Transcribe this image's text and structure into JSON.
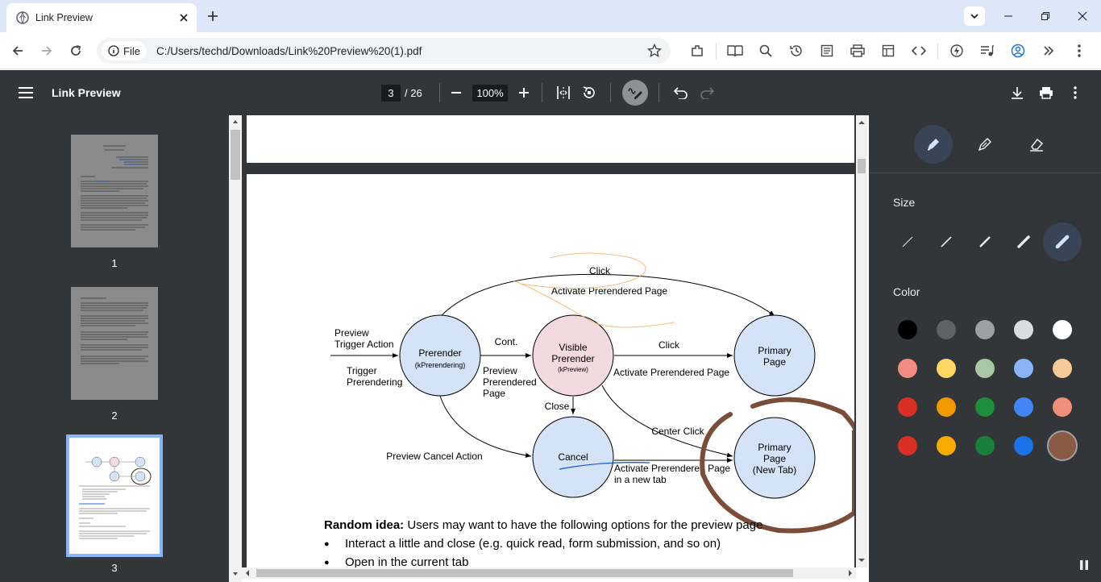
{
  "browser": {
    "tab_title": "Link Preview",
    "file_chip": "File",
    "url": "C:/Users/techd/Downloads/Link%20Preview%20(1).pdf"
  },
  "pdf_toolbar": {
    "title": "Link Preview",
    "current_page": "3",
    "total_pages": "/ 26",
    "zoom": "100%"
  },
  "thumbnails": {
    "labels": [
      "1",
      "2",
      "3"
    ],
    "selected": "3"
  },
  "diagram": {
    "click_top": "Click",
    "activate_top": "Activate Prerendered Page",
    "preview_trigger_1": "Preview",
    "preview_trigger_2": "Trigger Action",
    "trigger_prerendering_1": "Trigger",
    "trigger_prerendering_2": "Prerendering",
    "prerender_1": "Prerender",
    "prerender_2": "(kPrerendering)",
    "cont": "Cont.",
    "visible_1": "Visible",
    "visible_2": "Prerender",
    "visible_3": "(kPreview)",
    "preview_prerendered_1": "Preview",
    "preview_prerendered_2": "Prerendered",
    "preview_prerendered_3": "Page",
    "click_mid": "Click",
    "activate_mid": "Activate Prerendered Page",
    "primary_1": "Primary",
    "primary_2": "Page",
    "close": "Close",
    "center_click": "Center Click",
    "preview_cancel": "Preview Cancel Action",
    "cancel": "Cancel",
    "activate_newtab_1": "Activate Prerendered Page",
    "activate_newtab_2": "in a new tab",
    "newtab_1": "Primary",
    "newtab_2": "Page",
    "newtab_3": "(New Tab)"
  },
  "body_text": {
    "idea_label": "Random idea:",
    "idea_text": " Users may want to have the following options for the preview page",
    "bullet_1": "Interact a little and close (e.g. quick read, form submission, and so on)",
    "bullet_2": "Open in the current tab"
  },
  "annotation_panel": {
    "size_label": "Size",
    "color_label": "Color",
    "selected_tool": "pen",
    "selected_size_index": 4,
    "colors": [
      "#000000",
      "#5f6368",
      "#9aa0a6",
      "#dadce0",
      "#ffffff",
      "#f28b82",
      "#fdd663",
      "#a8c7a5",
      "#8ab4f8",
      "#f6c99a",
      "#d93025",
      "#f29900",
      "#1e8e3e",
      "#4285f4",
      "#ee9079",
      "#d93025",
      "#f9ab00",
      "#188038",
      "#1a73e8",
      "#8b5a44"
    ],
    "selected_color": "#8b5a44"
  },
  "accent": "#8ab4f8"
}
